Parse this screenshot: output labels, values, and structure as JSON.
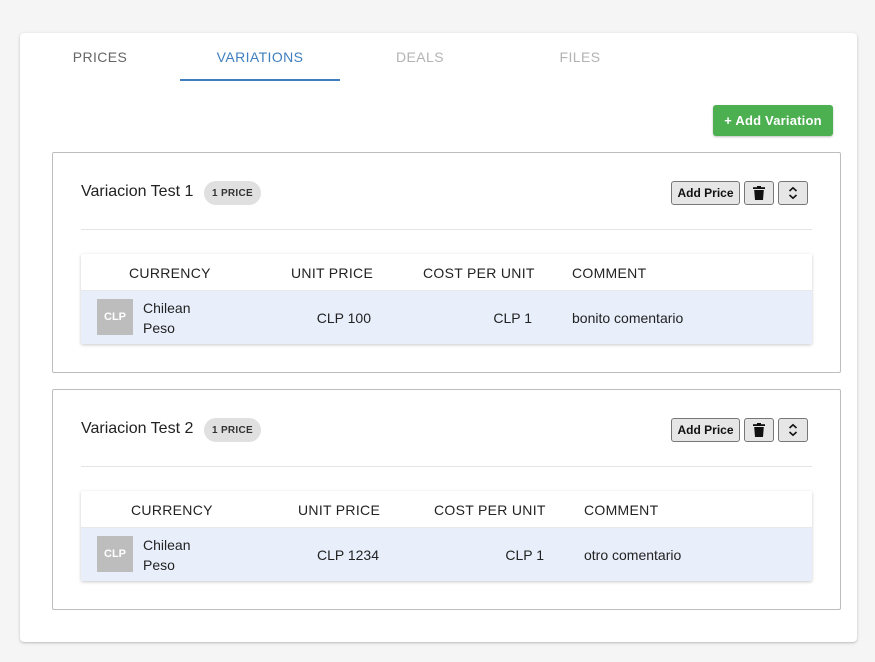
{
  "tabs": [
    {
      "label": "PRICES"
    },
    {
      "label": "VARIATIONS"
    },
    {
      "label": "DEALS"
    },
    {
      "label": "FILES"
    }
  ],
  "active_tab": "VARIATIONS",
  "colors": {
    "accent": "#3f7fbf",
    "add_button": "#4caf50",
    "row_highlight": "#e8effb"
  },
  "add_variation_label": "+ Add Variation",
  "variations": [
    {
      "title": "Variacion Test 1",
      "badge": "1 PRICE",
      "add_price_label": "Add Price",
      "delete_icon": "trash-icon",
      "collapse_icon": "collapse-icon",
      "columns": [
        "CURRENCY",
        "UNIT PRICE",
        "COST PER UNIT",
        "COMMENT"
      ],
      "rows": [
        {
          "code": "CLP",
          "currency": "Chilean Peso",
          "unit_price": "CLP 100",
          "cost_per_unit": "CLP 1",
          "comment": "bonito comentario"
        }
      ]
    },
    {
      "title": "Variacion Test 2",
      "badge": "1 PRICE",
      "add_price_label": "Add Price",
      "delete_icon": "trash-icon",
      "collapse_icon": "collapse-icon",
      "columns": [
        "CURRENCY",
        "UNIT PRICE",
        "COST PER UNIT",
        "COMMENT"
      ],
      "rows": [
        {
          "code": "CLP",
          "currency": "Chilean Peso",
          "unit_price": "CLP 1234",
          "cost_per_unit": "CLP 1",
          "comment": "otro comentario"
        }
      ]
    }
  ]
}
